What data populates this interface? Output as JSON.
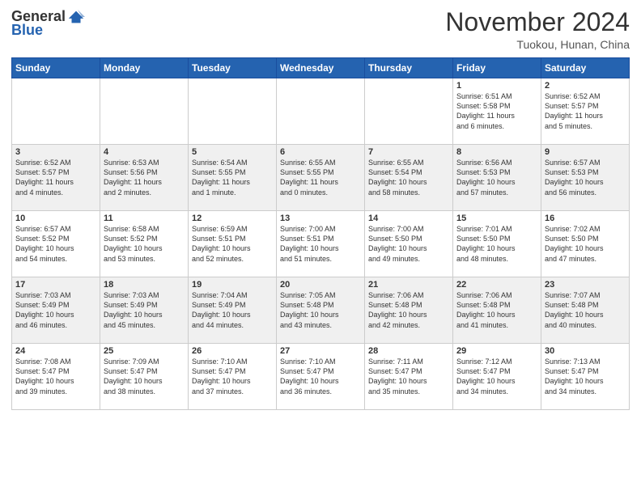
{
  "header": {
    "logo": {
      "general": "General",
      "blue": "Blue"
    },
    "title": "November 2024",
    "location": "Tuokou, Hunan, China"
  },
  "weekdays": [
    "Sunday",
    "Monday",
    "Tuesday",
    "Wednesday",
    "Thursday",
    "Friday",
    "Saturday"
  ],
  "weeks": [
    [
      {
        "day": "",
        "info": ""
      },
      {
        "day": "",
        "info": ""
      },
      {
        "day": "",
        "info": ""
      },
      {
        "day": "",
        "info": ""
      },
      {
        "day": "",
        "info": ""
      },
      {
        "day": "1",
        "info": "Sunrise: 6:51 AM\nSunset: 5:58 PM\nDaylight: 11 hours\nand 6 minutes."
      },
      {
        "day": "2",
        "info": "Sunrise: 6:52 AM\nSunset: 5:57 PM\nDaylight: 11 hours\nand 5 minutes."
      }
    ],
    [
      {
        "day": "3",
        "info": "Sunrise: 6:52 AM\nSunset: 5:57 PM\nDaylight: 11 hours\nand 4 minutes."
      },
      {
        "day": "4",
        "info": "Sunrise: 6:53 AM\nSunset: 5:56 PM\nDaylight: 11 hours\nand 2 minutes."
      },
      {
        "day": "5",
        "info": "Sunrise: 6:54 AM\nSunset: 5:55 PM\nDaylight: 11 hours\nand 1 minute."
      },
      {
        "day": "6",
        "info": "Sunrise: 6:55 AM\nSunset: 5:55 PM\nDaylight: 11 hours\nand 0 minutes."
      },
      {
        "day": "7",
        "info": "Sunrise: 6:55 AM\nSunset: 5:54 PM\nDaylight: 10 hours\nand 58 minutes."
      },
      {
        "day": "8",
        "info": "Sunrise: 6:56 AM\nSunset: 5:53 PM\nDaylight: 10 hours\nand 57 minutes."
      },
      {
        "day": "9",
        "info": "Sunrise: 6:57 AM\nSunset: 5:53 PM\nDaylight: 10 hours\nand 56 minutes."
      }
    ],
    [
      {
        "day": "10",
        "info": "Sunrise: 6:57 AM\nSunset: 5:52 PM\nDaylight: 10 hours\nand 54 minutes."
      },
      {
        "day": "11",
        "info": "Sunrise: 6:58 AM\nSunset: 5:52 PM\nDaylight: 10 hours\nand 53 minutes."
      },
      {
        "day": "12",
        "info": "Sunrise: 6:59 AM\nSunset: 5:51 PM\nDaylight: 10 hours\nand 52 minutes."
      },
      {
        "day": "13",
        "info": "Sunrise: 7:00 AM\nSunset: 5:51 PM\nDaylight: 10 hours\nand 51 minutes."
      },
      {
        "day": "14",
        "info": "Sunrise: 7:00 AM\nSunset: 5:50 PM\nDaylight: 10 hours\nand 49 minutes."
      },
      {
        "day": "15",
        "info": "Sunrise: 7:01 AM\nSunset: 5:50 PM\nDaylight: 10 hours\nand 48 minutes."
      },
      {
        "day": "16",
        "info": "Sunrise: 7:02 AM\nSunset: 5:50 PM\nDaylight: 10 hours\nand 47 minutes."
      }
    ],
    [
      {
        "day": "17",
        "info": "Sunrise: 7:03 AM\nSunset: 5:49 PM\nDaylight: 10 hours\nand 46 minutes."
      },
      {
        "day": "18",
        "info": "Sunrise: 7:03 AM\nSunset: 5:49 PM\nDaylight: 10 hours\nand 45 minutes."
      },
      {
        "day": "19",
        "info": "Sunrise: 7:04 AM\nSunset: 5:49 PM\nDaylight: 10 hours\nand 44 minutes."
      },
      {
        "day": "20",
        "info": "Sunrise: 7:05 AM\nSunset: 5:48 PM\nDaylight: 10 hours\nand 43 minutes."
      },
      {
        "day": "21",
        "info": "Sunrise: 7:06 AM\nSunset: 5:48 PM\nDaylight: 10 hours\nand 42 minutes."
      },
      {
        "day": "22",
        "info": "Sunrise: 7:06 AM\nSunset: 5:48 PM\nDaylight: 10 hours\nand 41 minutes."
      },
      {
        "day": "23",
        "info": "Sunrise: 7:07 AM\nSunset: 5:48 PM\nDaylight: 10 hours\nand 40 minutes."
      }
    ],
    [
      {
        "day": "24",
        "info": "Sunrise: 7:08 AM\nSunset: 5:47 PM\nDaylight: 10 hours\nand 39 minutes."
      },
      {
        "day": "25",
        "info": "Sunrise: 7:09 AM\nSunset: 5:47 PM\nDaylight: 10 hours\nand 38 minutes."
      },
      {
        "day": "26",
        "info": "Sunrise: 7:10 AM\nSunset: 5:47 PM\nDaylight: 10 hours\nand 37 minutes."
      },
      {
        "day": "27",
        "info": "Sunrise: 7:10 AM\nSunset: 5:47 PM\nDaylight: 10 hours\nand 36 minutes."
      },
      {
        "day": "28",
        "info": "Sunrise: 7:11 AM\nSunset: 5:47 PM\nDaylight: 10 hours\nand 35 minutes."
      },
      {
        "day": "29",
        "info": "Sunrise: 7:12 AM\nSunset: 5:47 PM\nDaylight: 10 hours\nand 34 minutes."
      },
      {
        "day": "30",
        "info": "Sunrise: 7:13 AM\nSunset: 5:47 PM\nDaylight: 10 hours\nand 34 minutes."
      }
    ]
  ]
}
